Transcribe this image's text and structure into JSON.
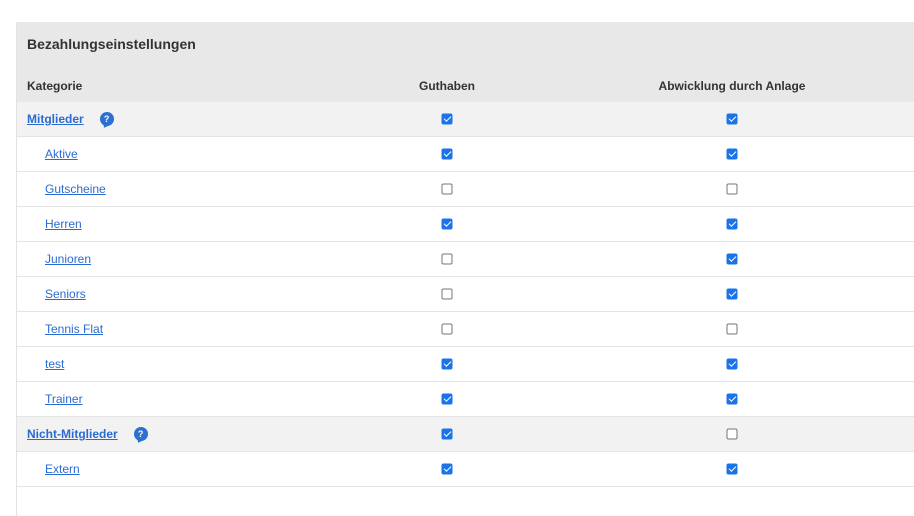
{
  "panel": {
    "title": "Bezahlungseinstellungen",
    "columns": {
      "kategorie": "Kategorie",
      "guthaben": "Guthaben",
      "abwicklung": "Abwicklung durch Anlage"
    }
  },
  "help_icon_glyph": "?",
  "rows": [
    {
      "label": "Mitglieder",
      "type": "group",
      "help": true,
      "guthaben": true,
      "abwicklung": true
    },
    {
      "label": "Aktive",
      "type": "sub",
      "help": false,
      "guthaben": true,
      "abwicklung": true
    },
    {
      "label": "Gutscheine",
      "type": "sub",
      "help": false,
      "guthaben": false,
      "abwicklung": false
    },
    {
      "label": "Herren",
      "type": "sub",
      "help": false,
      "guthaben": true,
      "abwicklung": true
    },
    {
      "label": "Junioren",
      "type": "sub",
      "help": false,
      "guthaben": false,
      "abwicklung": true
    },
    {
      "label": "Seniors",
      "type": "sub",
      "help": false,
      "guthaben": false,
      "abwicklung": true
    },
    {
      "label": "Tennis Flat",
      "type": "sub",
      "help": false,
      "guthaben": false,
      "abwicklung": false
    },
    {
      "label": "test",
      "type": "sub",
      "help": false,
      "guthaben": true,
      "abwicklung": true
    },
    {
      "label": "Trainer",
      "type": "sub",
      "help": false,
      "guthaben": true,
      "abwicklung": true
    },
    {
      "label": "Nicht-Mitglieder",
      "type": "group",
      "help": true,
      "guthaben": true,
      "abwicklung": false
    },
    {
      "label": "Extern",
      "type": "sub",
      "help": false,
      "guthaben": true,
      "abwicklung": true
    }
  ],
  "colors": {
    "header_bg": "#e8e8e8",
    "group_row_bg": "#f2f2f2",
    "link": "#2a6bd1",
    "checkbox_checked": "#1a73e8",
    "help_icon": "#2e6fd2"
  }
}
